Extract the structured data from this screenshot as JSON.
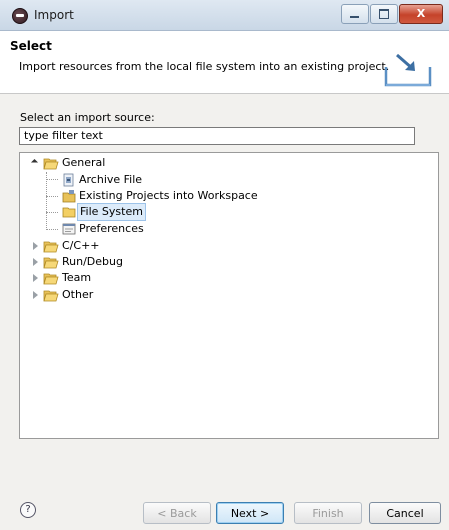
{
  "window": {
    "title": "Import",
    "close_glyph": "X"
  },
  "header": {
    "title": "Select",
    "description": "Import resources from the local file system into an existing project.",
    "icon": "import-wizard-icon"
  },
  "source": {
    "label": "Select an import source:",
    "filter_value": "type filter text"
  },
  "tree": {
    "items": [
      {
        "label": "General",
        "expanded": true,
        "icon": "folder-open-icon"
      },
      {
        "label": "Archive File",
        "icon": "archive-file-icon"
      },
      {
        "label": "Existing Projects into Workspace",
        "icon": "project-icon"
      },
      {
        "label": "File System",
        "icon": "folder-icon",
        "selected": true
      },
      {
        "label": "Preferences",
        "icon": "preferences-icon"
      },
      {
        "label": "C/C++",
        "expanded": false,
        "icon": "folder-open-icon"
      },
      {
        "label": "Run/Debug",
        "expanded": false,
        "icon": "folder-open-icon"
      },
      {
        "label": "Team",
        "expanded": false,
        "icon": "folder-open-icon"
      },
      {
        "label": "Other",
        "expanded": false,
        "icon": "folder-open-icon"
      }
    ]
  },
  "footer": {
    "help_glyph": "?",
    "back_label": "< Back",
    "next_label": "Next >",
    "finish_label": "Finish",
    "cancel_label": "Cancel"
  }
}
